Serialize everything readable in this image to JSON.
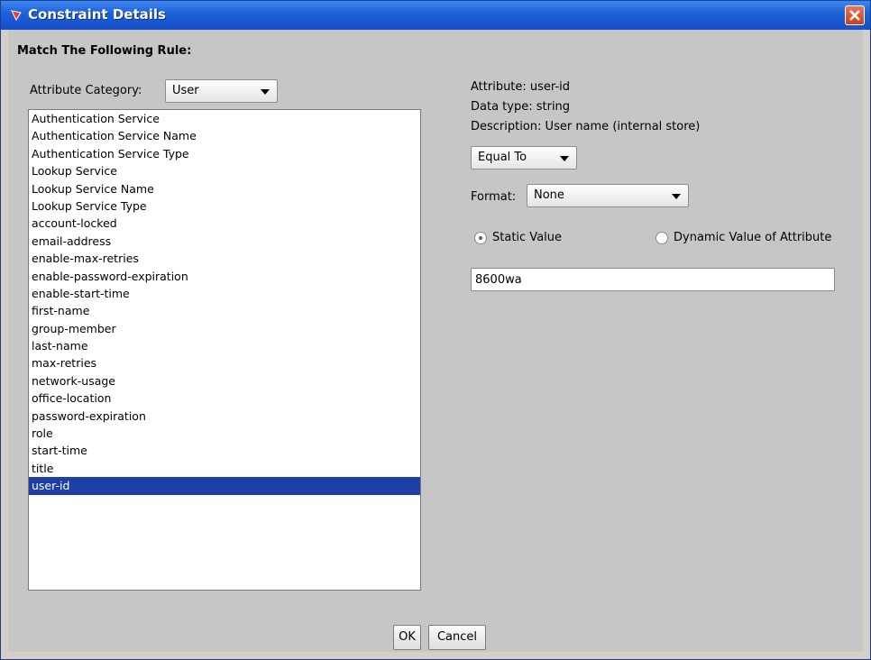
{
  "window": {
    "title": "Constraint Details"
  },
  "rule_heading": "Match The Following Rule:",
  "attribute_category": {
    "label": "Attribute Category:",
    "value": "User"
  },
  "attributes": [
    "Authentication Service",
    "Authentication Service Name",
    "Authentication Service Type",
    "Lookup Service",
    "Lookup Service Name",
    "Lookup Service Type",
    "account-locked",
    "email-address",
    "enable-max-retries",
    "enable-password-expiration",
    "enable-start-time",
    "first-name",
    "group-member",
    "last-name",
    "max-retries",
    "network-usage",
    "office-location",
    "password-expiration",
    "role",
    "start-time",
    "title",
    "user-id"
  ],
  "selected_attribute": "user-id",
  "details": {
    "attribute": "Attribute: user-id",
    "data_type": "Data type: string",
    "description": "Description: User name (internal store)"
  },
  "operator": {
    "value": "Equal To"
  },
  "format": {
    "label": "Format:",
    "value": "None"
  },
  "value_mode": {
    "static_label": "Static Value",
    "dynamic_label": "Dynamic Value of Attribute",
    "selected": "static"
  },
  "value_input": {
    "value": "8600wa"
  },
  "buttons": {
    "ok": "OK",
    "cancel": "Cancel"
  },
  "colors": {
    "titlebar": "#1e5fd8",
    "selection": "#1e3fa8",
    "background": "#c6c6c6"
  }
}
